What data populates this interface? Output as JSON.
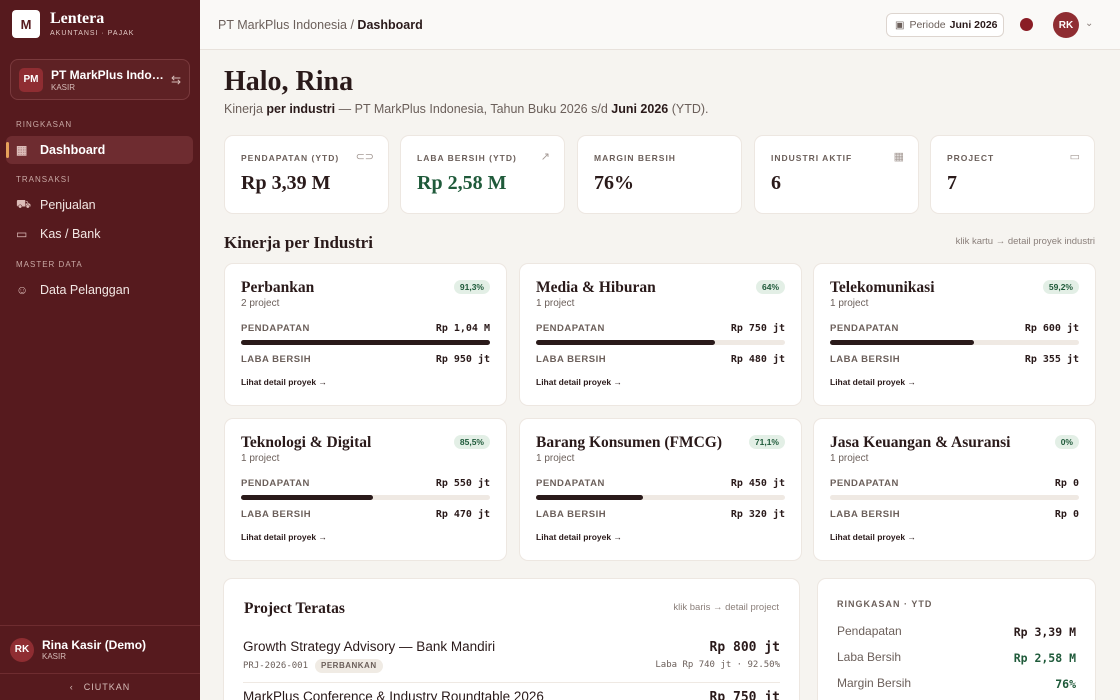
{
  "brand": {
    "logo": "M",
    "name": "Lentera",
    "sub": "AKUNTANSI · PAJAK"
  },
  "org": {
    "initials": "PM",
    "name": "PT MarkPlus Indonesia",
    "role": "KASIR"
  },
  "sidebar": {
    "sections": [
      "RINGKASAN",
      "TRANSAKSI",
      "MASTER DATA"
    ],
    "items": [
      {
        "label": "Dashboard",
        "icon": "grid-icon"
      },
      {
        "label": "Penjualan",
        "icon": "cart-icon"
      },
      {
        "label": "Kas / Bank",
        "icon": "wallet-icon"
      },
      {
        "label": "Data Pelanggan",
        "icon": "users-icon"
      }
    ],
    "user": {
      "initials": "RK",
      "name": "Rina Kasir (Demo)",
      "role": "KASIR"
    },
    "collapse": "CIUTKAN"
  },
  "topbar": {
    "crumb_org": "PT MarkPlus Indonesia",
    "crumb_sep": " / ",
    "crumb_page": "Dashboard",
    "period_label": "Periode",
    "period_value": "Juni 2026",
    "avatar": "RK"
  },
  "greeting": {
    "title": "Halo, Rina",
    "sub_1": "Kinerja ",
    "sub_2": "per industri",
    "sub_3": " — PT MarkPlus Indonesia, Tahun Buku 2026 s/d ",
    "sub_4": "Juni 2026",
    "sub_5": " (YTD)."
  },
  "kpis": [
    {
      "label": "PENDAPATAN (YTD)",
      "value": "Rp 3,39 M",
      "icon": "cash-icon"
    },
    {
      "label": "LABA BERSIH (YTD)",
      "value": "Rp 2,58 M",
      "icon": "trend-up-icon"
    },
    {
      "label": "MARGIN BERSIH",
      "value": "76%",
      "icon": ""
    },
    {
      "label": "INDUSTRI AKTIF",
      "value": "6",
      "icon": "building-icon"
    },
    {
      "label": "PROJECT",
      "value": "7",
      "icon": "folder-icon"
    }
  ],
  "industry_section": {
    "title": "Kinerja per Industri",
    "hint": "klik kartu → detail proyek industri"
  },
  "industries": [
    {
      "name": "Perbankan",
      "count": "2 project",
      "margin": "91,3%",
      "revenue": "Rp 1,04 M",
      "profit": "Rp 950 jt",
      "revenue_share": 1.0,
      "link": "Lihat detail proyek →"
    },
    {
      "name": "Media & Hiburan",
      "count": "1 project",
      "margin": "64%",
      "revenue": "Rp 750 jt",
      "profit": "Rp 480 jt",
      "revenue_share": 0.72,
      "link": "Lihat detail proyek →"
    },
    {
      "name": "Telekomunikasi",
      "count": "1 project",
      "margin": "59,2%",
      "revenue": "Rp 600 jt",
      "profit": "Rp 355 jt",
      "revenue_share": 0.58,
      "link": "Lihat detail proyek →"
    },
    {
      "name": "Teknologi & Digital",
      "count": "1 project",
      "margin": "85,5%",
      "revenue": "Rp 550 jt",
      "profit": "Rp 470 jt",
      "revenue_share": 0.53,
      "link": "Lihat detail proyek →"
    },
    {
      "name": "Barang Konsumen (FMCG)",
      "count": "1 project",
      "margin": "71,1%",
      "revenue": "Rp 450 jt",
      "profit": "Rp 320 jt",
      "revenue_share": 0.43,
      "link": "Lihat detail proyek →"
    },
    {
      "name": "Jasa Keuangan & Asuransi",
      "count": "1 project",
      "margin": "0%",
      "revenue": "Rp 0",
      "profit": "Rp 0",
      "revenue_share": 0,
      "link": "Lihat detail proyek →"
    }
  ],
  "labels": {
    "revenue": "PENDAPATAN",
    "profit": "LABA BERSIH"
  },
  "projects": {
    "title": "Project Teratas",
    "hint": "klik baris → detail project",
    "rows": [
      {
        "name": "Growth Strategy Advisory — Bank Mandiri",
        "code": "PRJ-2026-001",
        "tag": "PERBANKAN",
        "amount": "Rp 800 jt",
        "stat": "Laba Rp 740 jt · 92.50%"
      },
      {
        "name": "MarkPlus Conference & Industry Roundtable 2026",
        "code": "",
        "tag": "",
        "amount": "Rp 750 jt",
        "stat": ""
      }
    ]
  },
  "summary": {
    "title": "RINGKASAN · YTD",
    "rows": [
      {
        "label": "Pendapatan",
        "value": "Rp 3,39 M"
      },
      {
        "label": "Laba Bersih",
        "value": "Rp 2,58 M"
      },
      {
        "label": "Margin Bersih",
        "value": "76%"
      }
    ]
  }
}
